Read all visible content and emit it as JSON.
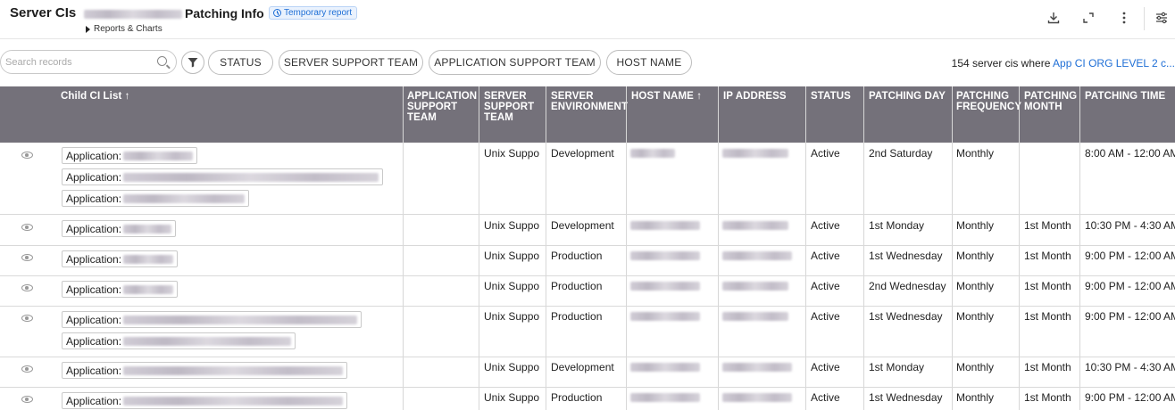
{
  "header": {
    "title": "Server CIs",
    "report_name": "Patching Info",
    "badge": "Temporary report",
    "reports_link": "Reports & Charts",
    "icons": [
      "download-icon",
      "expand-icon",
      "more-vert-icon",
      "settings-sliders-icon"
    ]
  },
  "filters": {
    "search_placeholder": "Search records",
    "pills": [
      "STATUS",
      "SERVER SUPPORT TEAM",
      "APPLICATION SUPPORT TEAM",
      "HOST NAME"
    ],
    "summary_count": "154 server cis where",
    "summary_link": "App CI ORG LEVEL 2 c..."
  },
  "table": {
    "columns": {
      "child_ci": "Child CI List ↑",
      "app_team_1": "APPLICATION",
      "app_team_2": "SUPPORT",
      "app_team_3": "TEAM",
      "srv_team_1": "SERVER",
      "srv_team_2": "SUPPORT",
      "srv_team_3": "TEAM",
      "srv_env_1": "SERVER",
      "srv_env_2": "ENVIRONMENT",
      "host": "HOST NAME ↑",
      "ip": "IP ADDRESS",
      "status": "STATUS",
      "day": "PATCHING DAY",
      "freq_1": "PATCHING",
      "freq_2": "FREQUENCY",
      "month_1": "PATCHING",
      "month_2": "MONTH",
      "time": "PATCHING TIME"
    },
    "app_prefix": "Application:",
    "rows": [
      {
        "server_team": "Unix Suppo",
        "env": "Development",
        "status": "Active",
        "day": "2nd Saturday",
        "freq": "Monthly",
        "month": "",
        "time": "8:00 AM - 12:00 AM"
      },
      {
        "server_team": "Unix Suppo",
        "env": "Development",
        "status": "Active",
        "day": "1st Monday",
        "freq": "Monthly",
        "month": "1st Month",
        "time": "10:30 PM - 4:30 AM"
      },
      {
        "server_team": "Unix Suppo",
        "env": "Production",
        "status": "Active",
        "day": "1st Wednesday",
        "freq": "Monthly",
        "month": "1st Month",
        "time": "9:00 PM - 12:00 AM"
      },
      {
        "server_team": "Unix Suppo",
        "env": "Production",
        "status": "Active",
        "day": "2nd Wednesday",
        "freq": "Monthly",
        "month": "1st Month",
        "time": "9:00 PM - 12:00 AM"
      },
      {
        "server_team": "Unix Suppo",
        "env": "Production",
        "status": "Active",
        "day": "1st Wednesday",
        "freq": "Monthly",
        "month": "1st Month",
        "time": "9:00 PM - 12:00 AM"
      },
      {
        "server_team": "Unix Suppo",
        "env": "Development",
        "status": "Active",
        "day": "1st Monday",
        "freq": "Monthly",
        "month": "1st Month",
        "time": "10:30 PM - 4:30 AM"
      },
      {
        "server_team": "Unix Suppo",
        "env": "Production",
        "status": "Active",
        "day": "1st Wednesday",
        "freq": "Monthly",
        "month": "1st Month",
        "time": "9:00 PM - 12:00 AM"
      }
    ]
  }
}
